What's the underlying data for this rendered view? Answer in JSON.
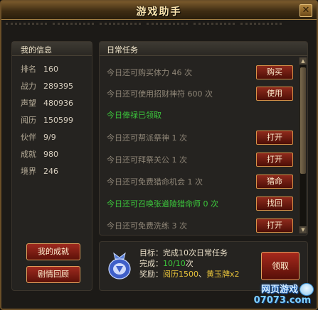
{
  "window": {
    "title": "游戏助手",
    "close_glyph": "✕"
  },
  "my_info": {
    "header": "我的信息",
    "stats": [
      {
        "label": "排名",
        "value": "160"
      },
      {
        "label": "战力",
        "value": "289395"
      },
      {
        "label": "声望",
        "value": "480936"
      },
      {
        "label": "阅历",
        "value": "150599"
      },
      {
        "label": "伙伴",
        "value": "9/9"
      },
      {
        "label": "成就",
        "value": "980"
      },
      {
        "label": "境界",
        "value": "246"
      }
    ],
    "buttons": {
      "achievement": "我的成就",
      "story": "剧情回顾"
    }
  },
  "daily": {
    "header": "日常任务",
    "tasks": [
      {
        "text": "今日还可购买体力 46 次",
        "button": "购买",
        "green": false
      },
      {
        "text": "今日还可使用招财神符 600 次",
        "button": "使用",
        "green": false
      },
      {
        "text": "今日俸禄已领取",
        "button": "",
        "green": true
      },
      {
        "text": "今日还可帮派祭神 1 次",
        "button": "打开",
        "green": false
      },
      {
        "text": "今日还可拜祭关公 1 次",
        "button": "打开",
        "green": false
      },
      {
        "text": "今日还可免费猎命机会 1 次",
        "button": "猎命",
        "green": false
      },
      {
        "text": "今日还可召唤张道陵猎命师 0 次",
        "button": "找回",
        "green": true
      },
      {
        "text": "今日还可免费洗练 3 次",
        "button": "打开",
        "green": false
      }
    ]
  },
  "reward": {
    "goal_label": "目标：",
    "goal_value": "完成10次日常任务",
    "done_label": "完成：",
    "done_value": "10/10",
    "done_suffix": "次",
    "reward_label": "奖励：",
    "reward_a": "阅历1500",
    "reward_sep": "、",
    "reward_b": "黄玉牌x2",
    "claim": "领取"
  },
  "watermark": {
    "top": "网页游戏",
    "bottom": "07073.com"
  },
  "colors": {
    "accent_red": "#9e2a1f",
    "gold_border": "#e0a05c",
    "green": "#3cc83c",
    "yellow": "#e6c23a"
  },
  "icons": [
    "close-icon",
    "reward-bag-icon",
    "scroll-up-icon",
    "scroll-down-icon"
  ]
}
